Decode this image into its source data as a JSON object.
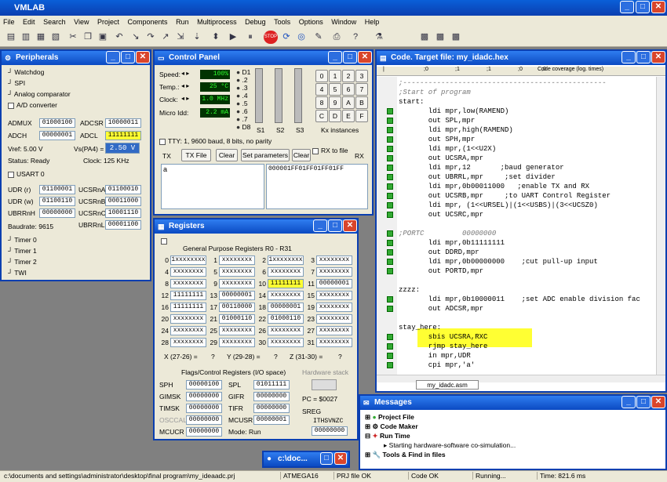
{
  "app": {
    "title": "VMLAB"
  },
  "menu": [
    "File",
    "Edit",
    "Search",
    "View",
    "Project",
    "Components",
    "Run",
    "Multiprocess",
    "Debug",
    "Tools",
    "Options",
    "Window",
    "Help"
  ],
  "toolbar": {
    "instance": "1"
  },
  "peripherals": {
    "title": "Peripherals",
    "groups": [
      "Watchdog",
      "SPI",
      "Analog comparator"
    ],
    "adc_title": "A/D converter",
    "admux_label": "ADMUX",
    "admux": "01000100",
    "adcsr_label": "ADCSR",
    "adcsr": "10000011",
    "adch_label": "ADCH",
    "adch": "00000001",
    "adcl_label": "ADCL",
    "adcl": "11111111",
    "vref": "Vref: 5.00 V",
    "vs_label": "Vs(PA4) =",
    "vs_value": "2.50 V",
    "status": "Status: Ready",
    "clock": "Clock:  125 KHz",
    "usart_title": "USART 0",
    "udr_r_label": "UDR (r)",
    "udr_r": "01100001",
    "ucsrna_label": "UCSRnA",
    "ucsrna": "01100010",
    "udr_w_label": "UDR (w)",
    "udr_w": "01100110",
    "ucsrnb_label": "UCSRnB",
    "ucsrnb": "00011000",
    "ubrrnh_label": "UBRRnH",
    "ubrrnh": "00000000",
    "ucsrnc_label": "UCSRnC",
    "ucsrnc": "10001110",
    "ubrrnl_label": "UBRRnL",
    "ubrrnl": "00001100",
    "baud": "Baudrate:  9615",
    "timers": [
      "Timer 0",
      "Timer 1",
      "Timer 2",
      "TWI"
    ]
  },
  "control": {
    "title": "Control Panel",
    "speed_label": "Speed:",
    "speed": "100%",
    "temp_label": "Temp.:",
    "temp": "25 °C",
    "clock_label": "Clock:",
    "clock": "1.0 MHz",
    "idd_label": "Micro Idd:",
    "idd": "2.2 mA",
    "leds": [
      "D1",
      ".2",
      ".3",
      ".4",
      ".5",
      ".6",
      ".7",
      "D8"
    ],
    "sliders": [
      "S1",
      "S2",
      "S3"
    ],
    "keys": [
      "0",
      "1",
      "2",
      "3",
      "4",
      "5",
      "6",
      "7",
      "8",
      "9",
      "A",
      "B",
      "C",
      "D",
      "E",
      "F"
    ],
    "kx": "Kx instances",
    "tty": "TTY: 1, 9600 baud, 8 bits, no parity",
    "tx_label": "TX",
    "tx_file": "TX File",
    "clear": "Clear",
    "set_params": "Set parameters",
    "clear2": "Clear",
    "rx_to_file": "RX to file",
    "rx_label": "RX",
    "tx_text": "a",
    "rx_text": "000001FF01FF01FF01FF"
  },
  "registers": {
    "title": "Registers",
    "gpr_title": "General Purpose Registers R0 - R31",
    "rows": [
      [
        "0",
        "1xxxxxxxx",
        "1",
        "xxxxxxxx",
        "2",
        "1xxxxxxxx",
        "3",
        "xxxxxxxx"
      ],
      [
        "4",
        "xxxxxxxx",
        "5",
        "xxxxxxxx",
        "6",
        "xxxxxxxx",
        "7",
        "xxxxxxxx"
      ],
      [
        "8",
        "xxxxxxxx",
        "9",
        "xxxxxxxx",
        "10",
        "11111111",
        "11",
        "00000001"
      ],
      [
        "12",
        "11111111",
        "13",
        "00000001",
        "14",
        "xxxxxxxx",
        "15",
        "xxxxxxxx"
      ],
      [
        "16",
        "11111111",
        "17",
        "00110000",
        "18",
        "00000001",
        "19",
        "xxxxxxxx"
      ],
      [
        "20",
        "xxxxxxxx",
        "21",
        "01000110",
        "22",
        "01000110",
        "23",
        "xxxxxxxx"
      ],
      [
        "24",
        "xxxxxxxx",
        "25",
        "xxxxxxxx",
        "26",
        "xxxxxxxx",
        "27",
        "xxxxxxxx"
      ],
      [
        "28",
        "xxxxxxxx",
        "29",
        "xxxxxxxx",
        "30",
        "xxxxxxxx",
        "31",
        "xxxxxxxx"
      ]
    ],
    "x_label": "X (27-26) =",
    "x_val": "?",
    "y_label": "Y (29-28) =",
    "y_val": "?",
    "z_label": "Z (31-30) =",
    "z_val": "?",
    "flags_title": "Flags/Control Registers (I/O space)",
    "stack_title": "Hardware stack",
    "sph_label": "SPH",
    "sph": "00000100",
    "spl_label": "SPL",
    "spl": "01011111",
    "gimsk_label": "GIMSK",
    "gimsk": "00000000",
    "gifr_label": "GIFR",
    "gifr": "00000000",
    "timsk_label": "TIMSK",
    "timsk": "00000000",
    "tifr_label": "TIFR",
    "tifr": "00000000",
    "osccal_label": "OSCCAL",
    "osccal": "00000000",
    "mcusr_label": "MCUSR",
    "mcusr": "00000001",
    "mcucr_label": "MCUCR",
    "mcucr": "00000000",
    "mode": "Mode:  Run",
    "pc": "PC = $0027",
    "sreg_label": "SREG",
    "sreg_flags": "ITHSVNZC",
    "sreg": "00000000"
  },
  "code": {
    "title": "Code. Target file: my_idadc.hex",
    "ruler": [
      "|",
      ";0",
      ";1",
      ";1",
      ";0",
      ";0",
      "Code coverage (log. times)"
    ],
    "lines": [
      ";------------------------------------------------",
      ";Start of program",
      "start:",
      "       ldi mpr,low(RAMEND)",
      "       out SPL,mpr",
      "       ldi mpr,high(RAMEND)",
      "       out SPH,mpr",
      "       ldi mpr,(1<<U2X)",
      "       out UCSRA,mpr",
      "       ldi mpr,12       ;baud generator",
      "       out UBRRL,mpr     ;set divider",
      "       ldi mpr,0b00011000   ;enable TX and RX",
      "       out UCSRB,mpr     ;to UART Control Register",
      "       ldi mpr, (1<<URSEL)|(1<<USBS)|(3<<UCSZ0)",
      "       out UCSRC,mpr",
      "",
      ";PORTC         00000000",
      "       ldi mpr,0b11111111",
      "       out DDRD,mpr",
      "       ldi mpr,0b00000000    ;cut pull-up input",
      "       out PORTD,mpr",
      "",
      "zzzz:",
      "       ldi mpr,0b10000011    ;set ADC enable division fac",
      "       out ADCSR,mpr",
      "",
      "stay_here:",
      "       sbis UCSRA,RXC",
      "       rjmp stay_here",
      "       in mpr,UDR",
      "       cpi mpr,'a'"
    ],
    "tab": "my_idadc.asm"
  },
  "messages": {
    "title": "Messages",
    "items": [
      "Project File",
      "Code Maker",
      "Run Time",
      "Tools & Find in files"
    ],
    "sub": "Starting hardware-software co-simulation..."
  },
  "mini": {
    "title": "c:\\doc..."
  },
  "status": {
    "path": "c:\\documents and settings\\administrator\\desktop\\final program\\my_ideaadc.prj",
    "chip": "ATMEGA16",
    "prj": "PRJ file OK",
    "code": "Code OK",
    "run": "Running...",
    "time": "Time:   821.6 ms"
  }
}
